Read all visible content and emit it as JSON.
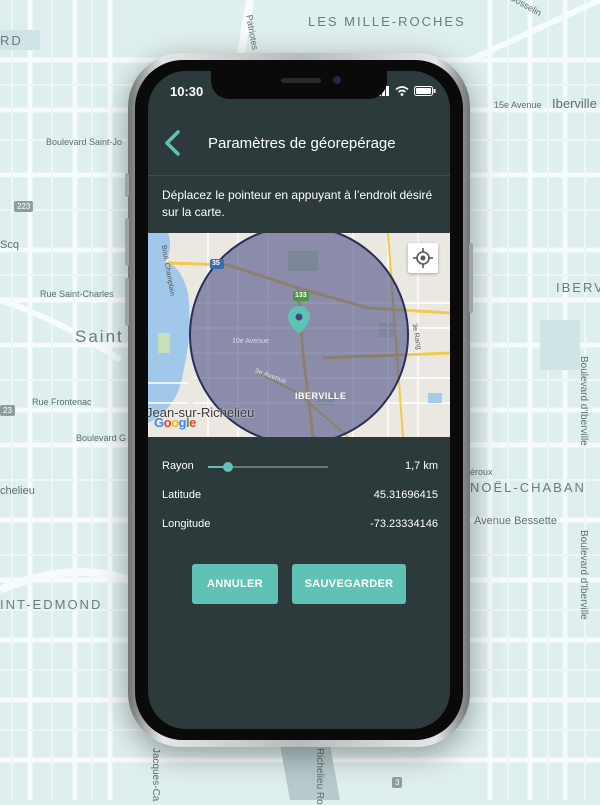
{
  "background_map": {
    "labels": {
      "les_mille_roches": "LES MILLE-ROCHES",
      "patriotes": "Patriotes",
      "gosselin": "Gosselin",
      "rd": "RD",
      "avenue_15e": "15e Avenue",
      "iberville_top": "Iberville",
      "blvd_saint_jo": "Boulevard Saint-Jo",
      "scq": "Scq",
      "rue_saint_charles": "Rue Saint-Charles",
      "saint": "Saint",
      "iberv": "IBERV",
      "rue_frontenac": "Rue Frontenac",
      "blvd_g": "Boulevard G",
      "chelieu": "chelieu",
      "roux": "éroux",
      "noel_chaban": "NOËL-CHABAN",
      "avenue_bessette": "Avenue Bessette",
      "blvd_diberville_1": "Boulevard d'Iberville",
      "blvd_diberville_2": "Boulevard d'Iberville",
      "int_edmond": "INT-EDMOND",
      "jacques_ca": "Jacques-Ca",
      "richelieu_ro": "Richelieu Ro"
    },
    "shields": {
      "s223": "223",
      "s23": "23",
      "s3": "3"
    }
  },
  "status_bar": {
    "time": "10:30"
  },
  "header": {
    "title": "Paramètres de géorepérage"
  },
  "instructions": "Déplacez le pointeur en appuyant à l’endroit désiré sur la carte.",
  "map": {
    "city_label": "Jean-sur-Richelieu",
    "district_label": "IBERVILLE",
    "street_label_1": "10e Avenue",
    "street_label_2": "9e Avenue",
    "street_label_3": "3e Rang",
    "street_label_4": "Boul. Champlain",
    "highway_35": "35",
    "highway_133": "133",
    "google_logo": "Google"
  },
  "settings": {
    "radius_label": "Rayon",
    "radius_value": "1,7 km",
    "radius_fraction": 0.17,
    "latitude_label": "Latitude",
    "latitude_value": "45.31696415",
    "longitude_label": "Longitude",
    "longitude_value": "-73.23334146"
  },
  "actions": {
    "cancel_label": "ANNULER",
    "save_label": "SAUVEGARDER"
  },
  "colors": {
    "accent": "#5ec3b5",
    "screen_bg": "#2d3a3c",
    "geofence_fill": "#4a4f86"
  }
}
